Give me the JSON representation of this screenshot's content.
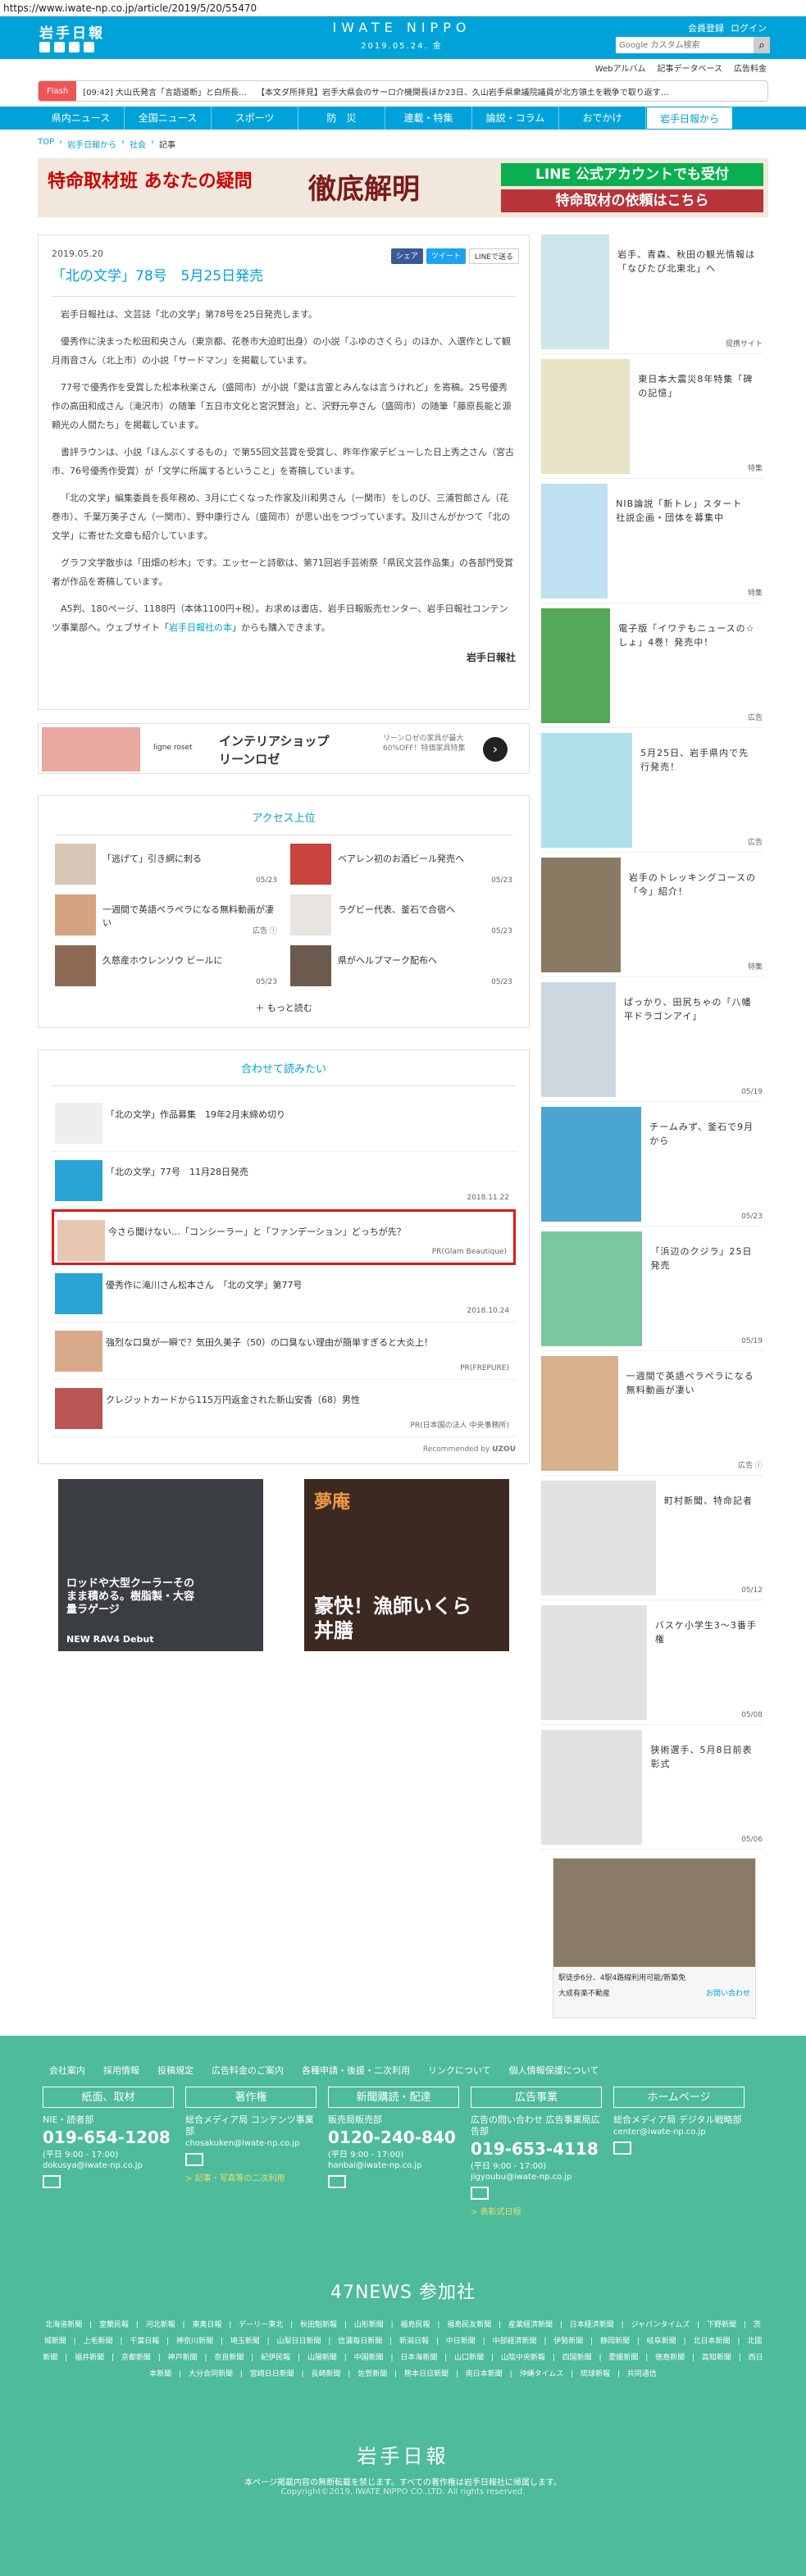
{
  "browser": {
    "url": "https://www.iwate-np.co.jp/article/2019/5/20/55470"
  },
  "header": {
    "logo": "岩手日報",
    "site_name": "IWATE NIPPO",
    "date": "2019.05.24. 金",
    "member_register": "会員登録",
    "login": "ログイン",
    "search_placeholder": "Google カスタム検索"
  },
  "subnav": [
    "Webアルバム",
    "記事データベース",
    "広告料金"
  ],
  "flash": {
    "label": "Flash",
    "items": [
      "[09:42] 大山氏発言「言語道断」と白所長…",
      "【本文ダ所拝見】岩手大県会のサーロ介機関長ほか23日、久山岩手県衆議院議員が北方領土を戦争で取り返す…"
    ]
  },
  "nav": [
    "県内ニュース",
    "全国ニュース",
    "スポーツ",
    "防　災",
    "連載・特集",
    "論説・コラム",
    "おでかけ",
    "岩手日報から"
  ],
  "breadcrumb": [
    "TOP",
    "岩手日報から",
    "社会",
    "記事"
  ],
  "banner": {
    "left": "特命取材班 あなたの疑問",
    "middle": "徹底解明",
    "line1": "LINE 公式アカウントでも受付",
    "line2": "特命取材の依頼はこちら"
  },
  "article": {
    "date": "2019.05.20",
    "share": [
      "シェア",
      "ツイート",
      "LINEで送る"
    ],
    "title": "「北の文学」78号　5月25日発売",
    "paragraphs": [
      "岩手日報社は、文芸誌「北の文学」第78号を25日発売します。",
      "優秀作に決まった松田和央さん（東京都、花巻市大迫町出身）の小説「ふゆのさくら」のほか、入選作として観月雨音さん（北上市）の小説「サードマン」を掲載しています。",
      "77号で優秀作を受賞した松本秋楽さん（盛岡市）が小説「愛は言霊とみんなは言うけれど」を寄稿。25号優秀作の高田和成さん（滝沢市）の随筆「五日市文化と宮沢賢治」と、沢野元亭さん（盛岡市）の随筆「藤原長能と源頼光の人間たち」を掲載しています。",
      "書評ラウンは、小説「ほんぷくするもの」で第55回文芸賞を受賞し、昨年作家デビューした日上秀之さん（宮古市、76号優秀作受賞）が「文学に所属するということ」を寄稿しています。",
      "「北の文学」編集委員を長年務め、3月に亡くなった作家及川和男さん（一関市）をしのび、三浦哲郎さん（花巻市）、千葉万美子さん（一関市）、野中康行さん（盛岡市）が思い出をつづっています。及川さんがかつて「北の文学」に寄せた文章も紹介しています。",
      "グラフ文学散歩は「田畑の杉木」です。エッセーと詩歌は、第71回岩手芸術祭「県民文芸作品集」の各部門受賞者が作品を寄稿しています。"
    ],
    "last_paragraph_text": "A5判、180ページ、1188円（本体1100円+税）。お求めは書店、岩手日報販売センター、岩手日報社コンテンツ事業部へ。ウェブサイト「",
    "last_paragraph_link": "岩手日報社の本",
    "last_paragraph_tail": "」からも購入できます。",
    "source": "岩手日報社"
  },
  "ad_interior": {
    "title1": "インテリアショップ",
    "title2": "リーンロゼ",
    "sub": "リーンロゼの家具が最大60%OFF！特価家具特集",
    "brand": "ligne roset"
  },
  "ranking": {
    "title": "アクセス上位",
    "items": [
      {
        "title": "「逃げて」引き網に刺る",
        "date": "05/23"
      },
      {
        "title": "ベアレン初のお酒ビール発売へ",
        "date": "05/23"
      },
      {
        "title": "一週間で英語ペラペラになる無料動画が凄い",
        "date": "広告 ⓘ"
      },
      {
        "title": "ラグビー代表、釜石で合宿へ",
        "date": "05/23"
      },
      {
        "title": "久慈産ホウレンソウ ビールに",
        "date": "05/23"
      },
      {
        "title": "県がヘルプマーク配布へ",
        "date": "05/23"
      }
    ],
    "more": "もっと読む"
  },
  "related": {
    "title": "合わせて読みたい",
    "items": [
      {
        "title": "「北の文学」作品募集　19年2月末締め切り",
        "meta": ""
      },
      {
        "title": "「北の文学」77号　11月28日発売",
        "meta": "2018.11.22"
      },
      {
        "title": "今さら聞けない…「コンシーラー」と「ファンデーション」どっちが先？",
        "meta": "PR(Glam Beautique)"
      },
      {
        "title": "優秀作に滝川さん松本さん　「北の文学」第77号",
        "meta": "2018.10.24"
      },
      {
        "title": "強烈な口臭が一瞬で？気田久美子（50）の口臭ない理由が簡単すぎると大炎上！",
        "meta": "PR(FREPURE)"
      },
      {
        "title": "クレジットカードから115万円返金された新山安香（68）男性",
        "meta": "PR(日本国の法人 中央事務所)"
      }
    ],
    "recommended": "Recommended by"
  },
  "ads_bottom": [
    {
      "text": "ロッドや大型クーラーそのまま積める。樹脂製・大容量ラゲージ",
      "brand": "NEW RAV4 Debut"
    },
    {
      "text": "豪快！漁師いくら丼膳",
      "brand": "夢庵"
    }
  ],
  "sidebar": [
    {
      "title": "岩手、青森、秋田の観光情報は「なびたび北東北」へ",
      "tag": "提携サイト",
      "color": "#cfe5ec"
    },
    {
      "title": "東日本大震災8年特集「碑の記憶」",
      "tag": "特集",
      "color": "#e9e3c5"
    },
    {
      "title": "NIB論説「新トレ」スタート　社説企画・団体を募集中",
      "tag": "特集",
      "color": "#bfe0f1"
    },
    {
      "title": "電子版「イワテもニュースの☆しょ」4巻！発売中！",
      "tag": "広告",
      "color": "#53a85a"
    },
    {
      "title": "5月25日、岩手県内で先行発売！",
      "tag": "広告",
      "color": "#aee1ea"
    },
    {
      "title": "岩手のトレッキングコースの「今」紹介！",
      "tag": "特集",
      "color": "#8b7a63"
    },
    {
      "title": "ぱっかり、田尻ちゃの「八幡平ドラゴンアイ」",
      "tag": "05/19",
      "color": "#cdd7df"
    },
    {
      "title": "チームみず、釜石で9月から",
      "tag": "05/23",
      "color": "#4aa5d1"
    },
    {
      "title": "「浜辺のクジラ」25日発売",
      "tag": "05/19",
      "color": "#7cc7a0"
    },
    {
      "title": "一週間で英語ペラペラになる無料動画が凄い",
      "tag": "広告 ⓘ",
      "color": "#d9b08c"
    },
    {
      "title": "町村新聞、特命記者",
      "tag": "05/12",
      "color": "#e2e2e2"
    },
    {
      "title": "バスケ小学生3～3番手権",
      "tag": "05/08",
      "color": "#e2e2e2"
    },
    {
      "title": "狭術選手、5月8日前表彰式",
      "tag": "05/06",
      "color": "#e2e2e2"
    }
  ],
  "side_ad": {
    "caption": "駅徒歩6分、4駅4路線利用可能/新築免",
    "brand": "大成有楽不動産",
    "link": "お問い合わせ"
  },
  "footer": {
    "links": [
      "会社案内",
      "採用情報",
      "投稿規定",
      "広告料金のご案内",
      "各種申請・後援・二次利用",
      "リンクについて",
      "個人情報保護について"
    ],
    "columns": [
      {
        "head": "紙面、取材",
        "t": "NIE・読者部",
        "phone": "019-654-1208",
        "hours": "(平日 9:00 - 17:00)",
        "email": "dokusya@iwate-np.co.jp",
        "link": ""
      },
      {
        "head": "著作権",
        "t": "総合メディア局 コンテンツ事業部",
        "phone": "",
        "hours": "",
        "email": "chosakuken@iwate-np.co.jp",
        "link": "> 記事・写真等の二次利用"
      },
      {
        "head": "新聞購読・配達",
        "t": "販売局販売部",
        "phone": "0120-240-840",
        "hours": "(平日 9:00 - 17:00)",
        "email": "hanbai@iwate-np.co.jp",
        "link": ""
      },
      {
        "head": "広告事業",
        "t": "広告の問い合わせ 広告事業局広告部",
        "phone": "019-653-4118",
        "hours": "(平日 9:00 - 17:00)",
        "email": "jigyoubu@iwate-np.co.jp",
        "link": "> 表彰式日程"
      },
      {
        "head": "ホームページ",
        "t": "総合メディア局 デジタル戦略部",
        "phone": "",
        "hours": "",
        "email": "center@iwate-np.co.jp",
        "link": ""
      }
    ],
    "news47": "47NEWS 参加社",
    "members": "北海道新聞 | 室蘭民報 | 河北新報 | 東奥日報 | デーリー東北 | 秋田魁新報 | 山形新聞 | 福島民報 | 福島民友新聞 | 産業経済新聞 | 日本経済新聞 | ジャパンタイムズ | 下野新聞 | 茨城新聞 | 上毛新聞 | 千葉日報 | 神奈川新聞 | 埼玉新聞 | 山梨日日新聞 | 信濃毎日新聞 | 新潟日報 | 中日新聞 | 中部経済新聞 | 伊勢新聞 | 静岡新聞 | 岐阜新聞 | 北日本新聞 | 北國新聞 | 福井新聞 | 京都新聞 | 神戸新聞 | 奈良新聞 | 紀伊民報 | 山陽新聞 | 中国新聞 | 日本海新聞 | 山口新聞 | 山陰中央新報 | 四国新聞 | 愛媛新聞 | 徳島新聞 | 高知新聞 | 西日本新聞 | 大分合同新聞 | 宮崎日日新聞 | 長崎新聞 | 佐賀新聞 | 熊本日日新聞 | 南日本新聞 | 沖縄タイムス | 琉球新報 | 共同通信",
    "logo": "岩手日報",
    "notice": "本ページ掲載内容の無断転載を禁じます。すべての著作権は岩手日報社に帰属します。",
    "copyright": "Copyright©2019, IWATE NIPPO CO.,LTD. All rights reserved."
  }
}
